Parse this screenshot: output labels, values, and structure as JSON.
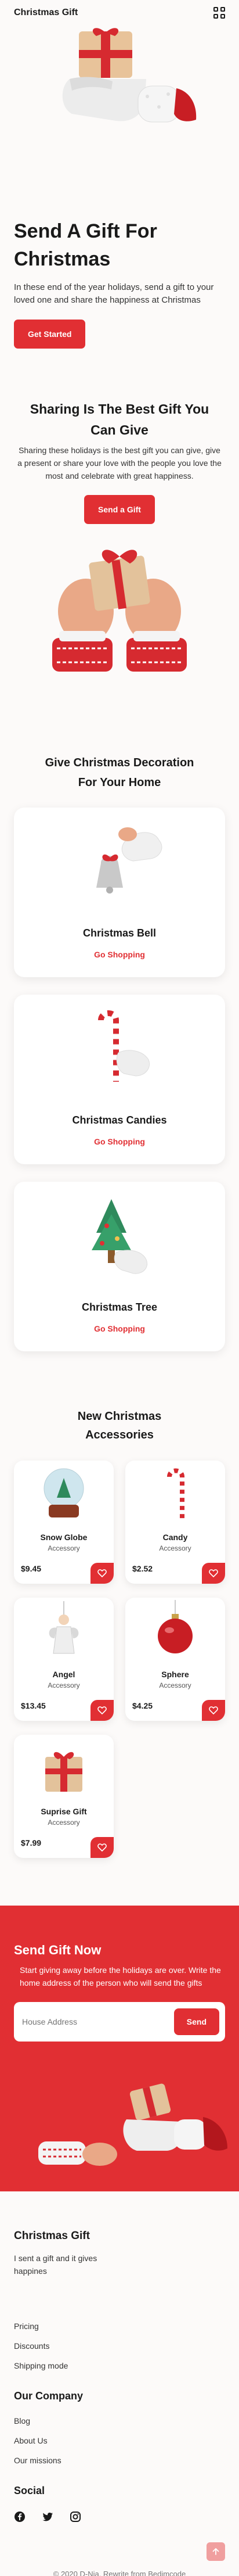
{
  "header": {
    "logo": "Christmas Gift",
    "menu_icon": "grid-menu-icon"
  },
  "hero": {
    "title": "Send A Gift For Christmas",
    "text": "In these end of the year holidays, send a gift to your loved one and share the happiness at Christmas",
    "button": "Get Started"
  },
  "share": {
    "title": "Sharing Is The Best Gift You Can Give",
    "text": "Sharing these holidays is the best gift you can give, give a present or share your love with the people you love the most and celebrate with great happiness.",
    "button": "Send a Gift"
  },
  "decoration": {
    "title": "Give Christmas Decoration For Your Home",
    "cards": [
      {
        "title": "Christmas Bell",
        "link": "Go Shopping"
      },
      {
        "title": "Christmas Candies",
        "link": "Go Shopping"
      },
      {
        "title": "Christmas Tree",
        "link": "Go Shopping"
      }
    ]
  },
  "accessories": {
    "title": "New Christmas Accessories",
    "items": [
      {
        "name": "Snow Globe",
        "type": "Accessory",
        "price": "$9.45"
      },
      {
        "name": "Candy",
        "type": "Accessory",
        "price": "$2.52"
      },
      {
        "name": "Angel",
        "type": "Accessory",
        "price": "$13.45"
      },
      {
        "name": "Sphere",
        "type": "Accessory",
        "price": "$4.25"
      },
      {
        "name": "Suprise Gift",
        "type": "Accessory",
        "price": "$7.99"
      }
    ]
  },
  "send": {
    "title": "Send Gift Now",
    "text": "Start giving away before the holidays are over. Write the home address of the person who will send the gifts",
    "input_placeholder": "House Address",
    "button": "Send"
  },
  "footer": {
    "brand": "Christmas Gift",
    "desc": "I sent a gift and it gives happines",
    "links": [
      "Pricing",
      "Discounts",
      "Shipping mode"
    ],
    "company_title": "Our Company",
    "company_links": [
      "Blog",
      "About Us",
      "Our missions"
    ],
    "social_title": "Social",
    "copyright": "© 2020 D-Nia. Rewrite from Bedimcode"
  },
  "colors": {
    "accent": "#e12f33",
    "background": "#fcfaf9"
  }
}
